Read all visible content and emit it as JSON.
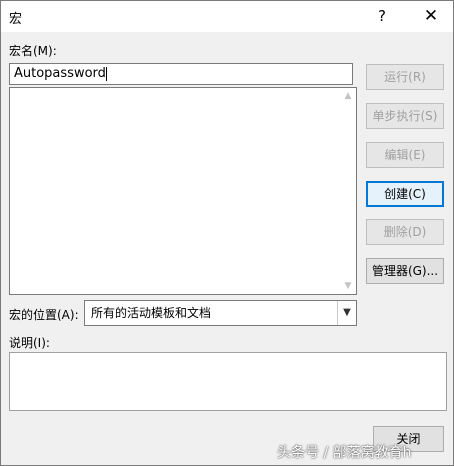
{
  "window": {
    "title": "宏",
    "help_glyph": "?",
    "close_glyph": "✕"
  },
  "macro_name": {
    "label": "宏名(M):",
    "value": "Autopassword"
  },
  "buttons": {
    "run": "运行(R)",
    "step_into": "单步执行(S)",
    "edit": "编辑(E)",
    "create": "创建(C)",
    "delete": "删除(D)",
    "organizer": "管理器(G)...",
    "close": "关闭"
  },
  "macros_in": {
    "label": "宏的位置(A):",
    "value": "所有的活动模板和文档"
  },
  "description": {
    "label": "说明(I):",
    "value": ""
  },
  "watermark": "头条号 / 部落窝教育h"
}
